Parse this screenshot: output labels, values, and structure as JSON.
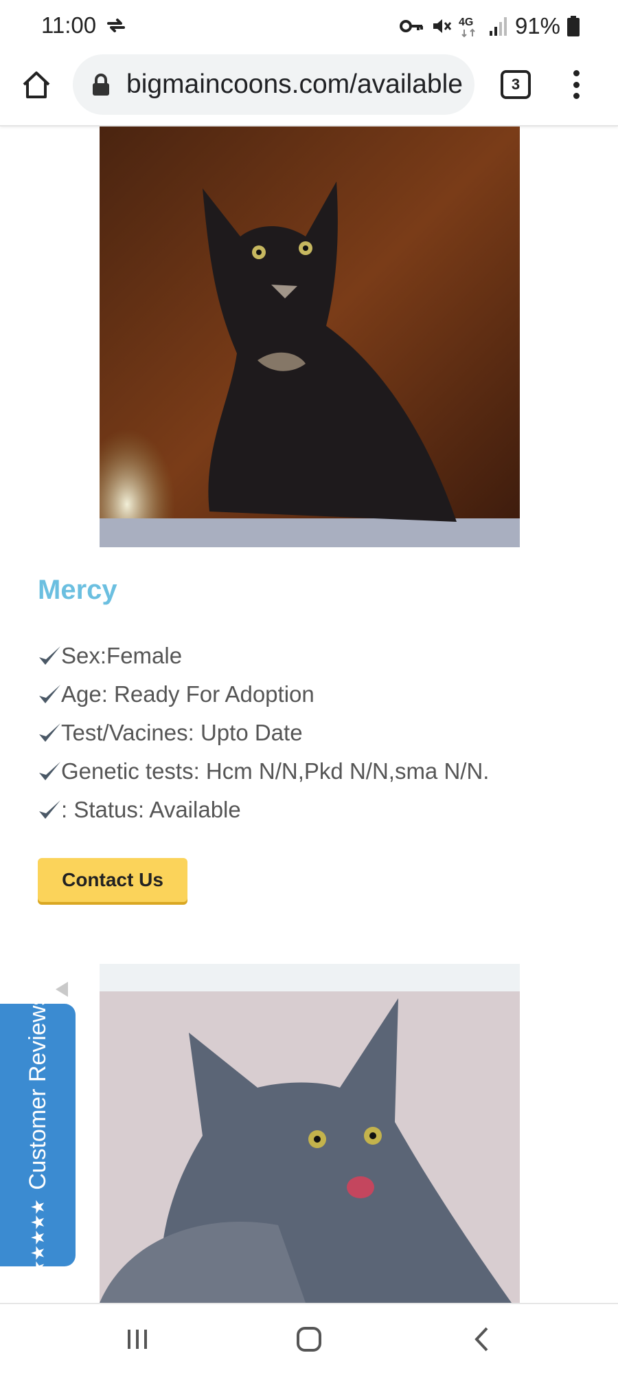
{
  "status_bar": {
    "time": "11:00",
    "network": "4G",
    "battery": "91%"
  },
  "browser": {
    "url": "bigmaincoons.com/available",
    "tab_count": "3"
  },
  "kitten": {
    "name": "Mercy",
    "details": [
      "Sex:Female",
      "Age: Ready For Adoption",
      "Test/Vacines: Upto Date",
      "Genetic tests: Hcm N/N,Pkd N/N,sma N/N.",
      ": Status: Available"
    ],
    "contact_label": "Contact Us"
  },
  "reviews_tab": {
    "stars": "★★★★★",
    "label": "Customer Reviews"
  },
  "colors": {
    "name_accent": "#6bbfe0",
    "contact_button": "#fbd35a",
    "reviews_tab": "#3b8bd1"
  },
  "icons": [
    "sync-icon",
    "key-icon",
    "mute-icon",
    "signal-icon",
    "battery-icon",
    "home-icon",
    "lock-icon",
    "tab-switcher-icon",
    "more-menu-icon",
    "checkmark-icon",
    "collapse-arrow-icon",
    "recent-apps-icon",
    "home-nav-icon",
    "back-icon"
  ]
}
